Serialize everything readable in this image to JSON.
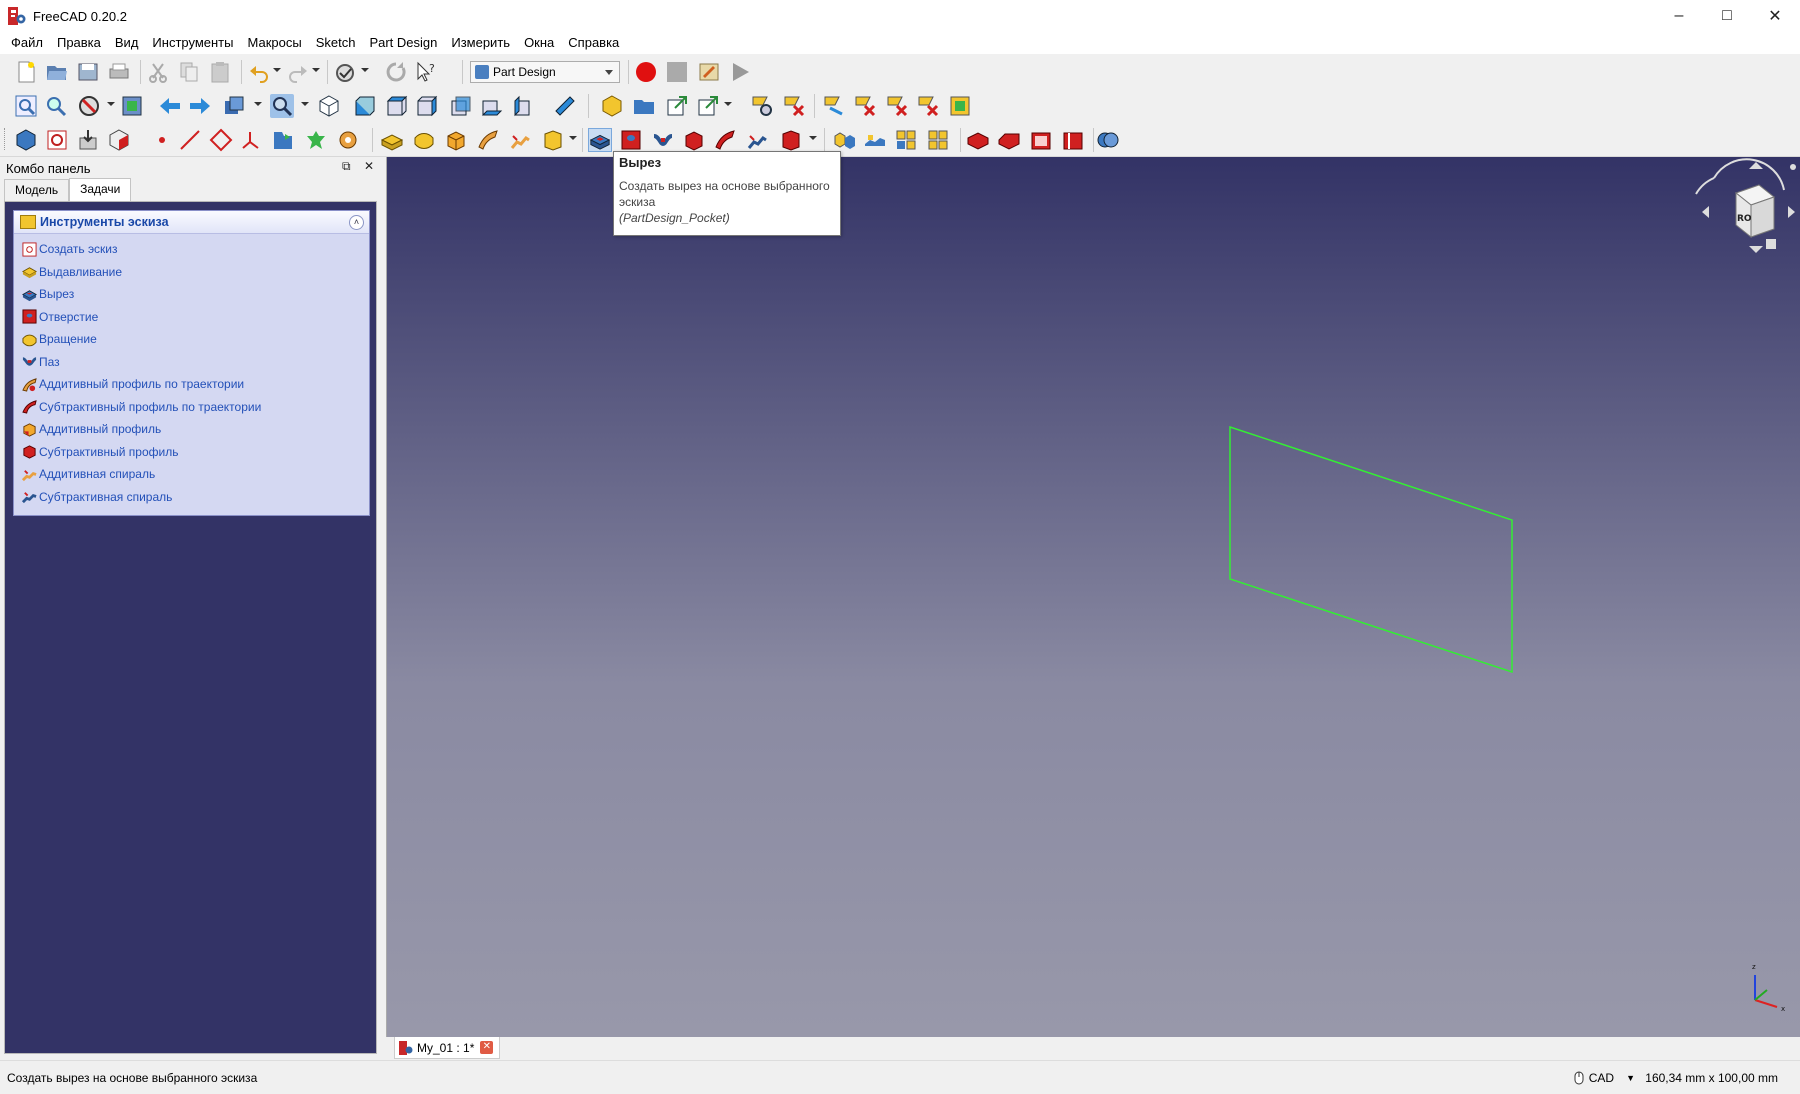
{
  "window": {
    "title": "FreeCAD 0.20.2"
  },
  "menu": [
    "Файл",
    "Правка",
    "Вид",
    "Инструменты",
    "Макросы",
    "Sketch",
    "Part Design",
    "Измерить",
    "Окна",
    "Справка"
  ],
  "toolbar": {
    "workbench": "Part Design"
  },
  "panel": {
    "title": "Комбо панель",
    "tabs": [
      "Модель",
      "Задачи"
    ],
    "task_title": "Инструменты эскиза",
    "tasks": [
      "Создать эскиз",
      "Выдавливание",
      "Вырез",
      "Отверстие",
      "Вращение",
      "Паз",
      "Аддитивный профиль по траектории",
      "Субтрактивный профиль по траектории",
      "Аддитивный профиль",
      "Субтрактивный профиль",
      "Аддитивная спираль",
      "Субтрактивная спираль"
    ]
  },
  "tooltip": {
    "title": "Вырез",
    "description": "Создать вырез на основе выбранного эскиза",
    "command": "(PartDesign_Pocket)"
  },
  "document": {
    "tab_label": "My_01 : 1*"
  },
  "status": {
    "message": "Создать вырез на основе выбранного эскиза",
    "navigation": "CAD",
    "dimensions": "160,34 mm x 100,00 mm"
  },
  "colors": {
    "view_top": "#333366",
    "view_bottom": "#9898aa",
    "sketch_line": "#33ee33",
    "task_link": "#2350b8"
  }
}
